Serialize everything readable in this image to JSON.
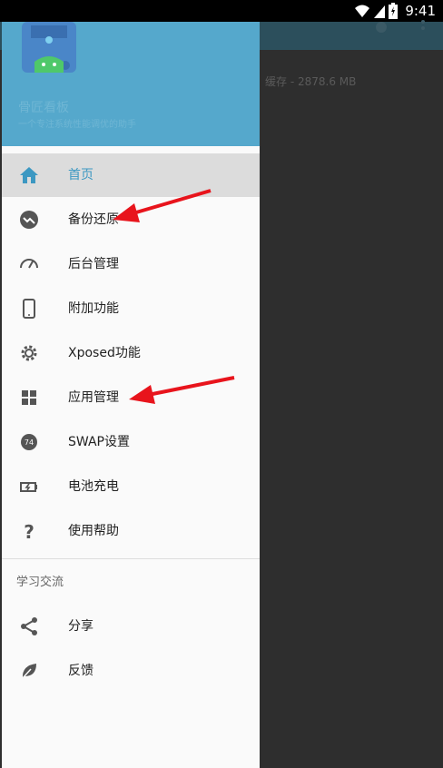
{
  "status_bar": {
    "time": "9:41"
  },
  "background_app": {
    "subtitle": "缓存 - 2878.6 MB"
  },
  "drawer": {
    "header": {
      "title": "骨匠看板",
      "subtitle": "一个专注系统性能调优的助手"
    },
    "menu": [
      {
        "label": "首页",
        "icon": "home-icon",
        "active": true
      },
      {
        "label": "备份还原",
        "icon": "backup-restore-icon",
        "active": false
      },
      {
        "label": "后台管理",
        "icon": "speedometer-icon",
        "active": false
      },
      {
        "label": "附加功能",
        "icon": "phone-icon",
        "active": false
      },
      {
        "label": "Xposed功能",
        "icon": "gear-icon",
        "active": false
      },
      {
        "label": "应用管理",
        "icon": "apps-grid-icon",
        "active": false
      },
      {
        "label": "SWAP设置",
        "icon": "swap-badge-icon",
        "active": false,
        "badge": "74"
      },
      {
        "label": "电池充电",
        "icon": "battery-charging-icon",
        "active": false
      },
      {
        "label": "使用帮助",
        "icon": "help-icon",
        "active": false
      }
    ],
    "section_title": "学习交流",
    "section_menu": [
      {
        "label": "分享",
        "icon": "share-icon"
      },
      {
        "label": "反馈",
        "icon": "leaf-feedback-icon"
      }
    ]
  },
  "colors": {
    "header_bg": "#55a8cc",
    "active_bg": "#dcdcdc",
    "active_text": "#3c98c2",
    "annotation_arrow": "#e8141c"
  }
}
